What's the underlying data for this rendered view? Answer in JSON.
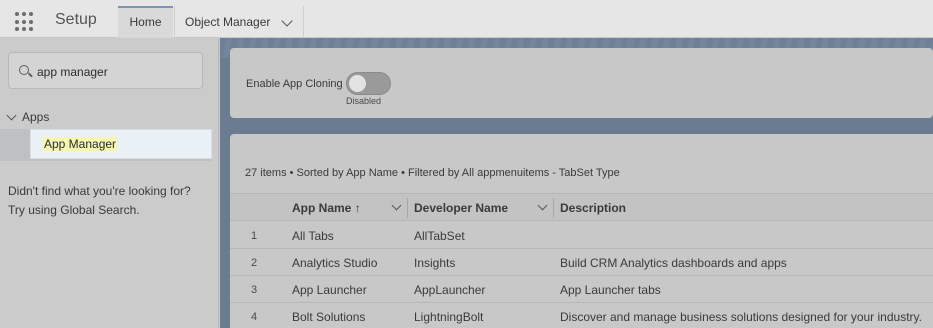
{
  "header": {
    "app_name": "Setup",
    "tabs": [
      {
        "label": "Home"
      },
      {
        "label": "Object Manager"
      }
    ]
  },
  "sidebar": {
    "search_value": "app manager",
    "tree_group": "Apps",
    "selected_item": "App Manager",
    "help_line1": "Didn't find what you're looking for?",
    "help_line2": "Try using Global Search."
  },
  "settings": {
    "clone_label": "Enable App Cloning",
    "clone_state": "Disabled",
    "clone_enabled": false
  },
  "list": {
    "summary": "27 items • Sorted by App Name • Filtered by All appmenuitems - TabSet Type",
    "columns": {
      "app_name": "App Name",
      "developer_name": "Developer Name",
      "description": "Description"
    },
    "rows": [
      {
        "num": "1",
        "app_name": "All Tabs",
        "developer_name": "AllTabSet",
        "description": ""
      },
      {
        "num": "2",
        "app_name": "Analytics Studio",
        "developer_name": "Insights",
        "description": "Build CRM Analytics dashboards and apps"
      },
      {
        "num": "3",
        "app_name": "App Launcher",
        "developer_name": "AppLauncher",
        "description": "App Launcher tabs"
      },
      {
        "num": "4",
        "app_name": "Bolt Solutions",
        "developer_name": "LightningBolt",
        "description": "Discover and manage business solutions designed for your industry."
      }
    ]
  }
}
